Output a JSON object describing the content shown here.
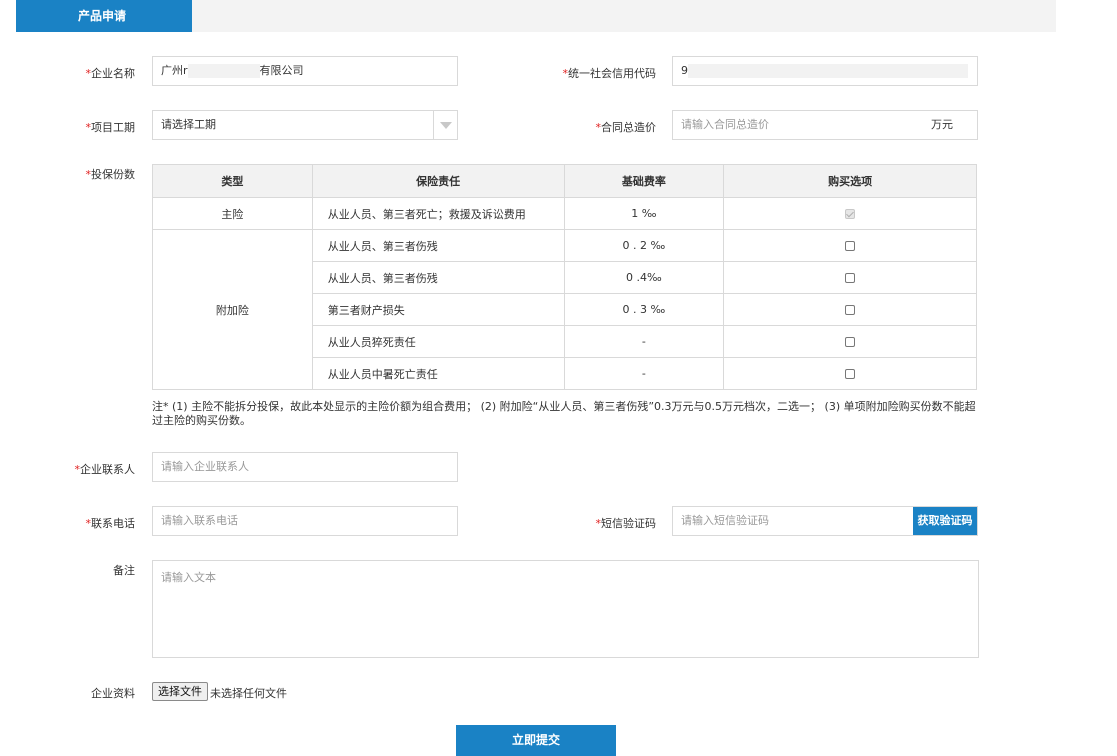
{
  "header": {
    "tab_label": "产品申请"
  },
  "form": {
    "required_mark": "*",
    "company_name": {
      "label": "企业名称",
      "value_prefix": "广州r",
      "value_suffix": "有限公司"
    },
    "credit_code": {
      "label": "统一社会信用代码",
      "value_prefix": "9"
    },
    "project_period": {
      "label": "项目工期",
      "value": "请选择工期"
    },
    "contract_price": {
      "label": "合同总造价",
      "placeholder": "请输入合同总造价",
      "unit": "万元"
    },
    "insurance_count": {
      "label": "投保份数"
    },
    "contact": {
      "label": "企业联系人",
      "placeholder": "请输入企业联系人"
    },
    "phone": {
      "label": "联系电话",
      "placeholder": "请输入联系电话"
    },
    "sms_code": {
      "label": "短信验证码",
      "placeholder": "请输入短信验证码",
      "button": "获取验证码"
    },
    "remark": {
      "label": "备注",
      "placeholder": "请输入文本"
    },
    "documents": {
      "label": "企业资料",
      "button": "选择文件",
      "status": "未选择任何文件"
    },
    "submit": "立即提交"
  },
  "table": {
    "headers": [
      "类型",
      "保险责任",
      "基础费率",
      "购买选项"
    ],
    "main_type": "主险",
    "addon_type": "附加险",
    "rows": [
      {
        "liability": "从业人员、第三者死亡；救援及诉讼费用",
        "rate": "1 ‰",
        "checked": true,
        "disabled": true
      },
      {
        "liability": "从业人员、第三者伤残",
        "rate": "0 . 2 ‰",
        "checked": false
      },
      {
        "liability": "从业人员、第三者伤残",
        "rate": "0 .4‰",
        "checked": false
      },
      {
        "liability": "第三者财产损失",
        "rate": "0 . 3 ‰",
        "checked": false
      },
      {
        "liability": "从业人员猝死责任",
        "rate": "-",
        "checked": false
      },
      {
        "liability": "从业人员中暑死亡责任",
        "rate": "-",
        "checked": false
      }
    ]
  },
  "note": "注*  (1) 主险不能拆分投保，故此本处显示的主险价额为组合费用；  (2) 附加险“从业人员、第三者伤残”0.3万元与0.5万元档次，二选一；  (3) 单项附加险购买份数不能超过主险的购买份数。"
}
